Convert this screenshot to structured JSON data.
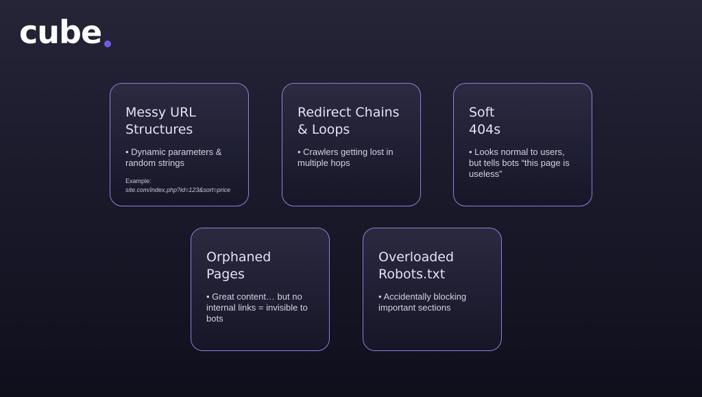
{
  "logo": {
    "text": "cube",
    "dot_color": "#6f5ce6"
  },
  "cards": [
    {
      "title_lines": [
        "Messy URL",
        "Structures"
      ],
      "bullet": "• Dynamic parameters & random strings",
      "example_label": "Example:",
      "example_url": "site.com/index.php?id=123&sort=price"
    },
    {
      "title_lines": [
        "Redirect Chains",
        "& Loops"
      ],
      "bullet": "• Crawlers getting lost in multiple hops"
    },
    {
      "title_lines": [
        "Soft",
        "404s"
      ],
      "bullet": "• Looks normal to users, but tells bots “this page is useless”"
    },
    {
      "title_lines": [
        "Orphaned",
        "Pages"
      ],
      "bullet": "• Great content… but no internal links = invisible to bots"
    },
    {
      "title_lines": [
        "Overloaded",
        "Robots.txt"
      ],
      "bullet": "• Accidentally blocking important sections"
    }
  ],
  "colors": {
    "card_border": "#8b86e0",
    "background": "#1a1a2b",
    "accent": "#6f5ce6"
  }
}
